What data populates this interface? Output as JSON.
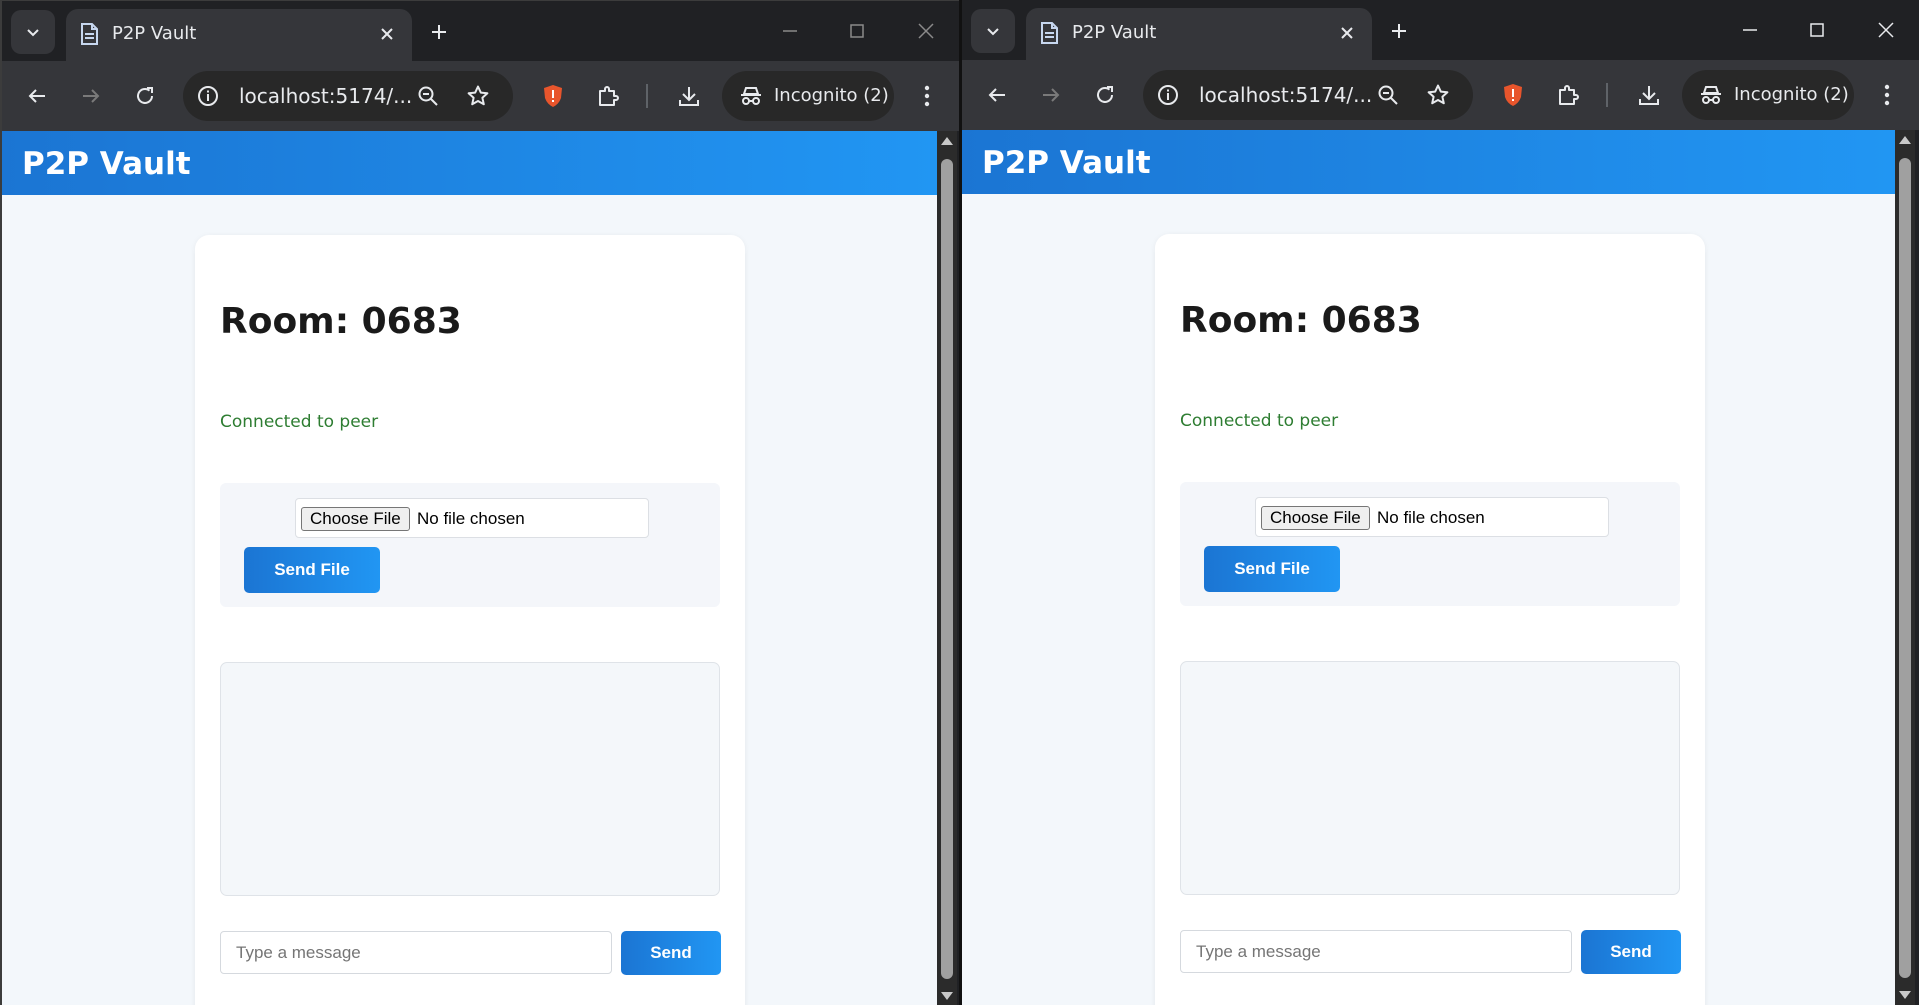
{
  "colors": {
    "brand_blue": "#1b75d3",
    "brand_blue_light": "#2196f3",
    "status_green": "#2e7d32",
    "chrome_dark": "#202124",
    "chrome_toolbar": "#35363a",
    "brave_shield": "#e8552c"
  },
  "windows": [
    {
      "tab": {
        "title": "P2P Vault",
        "favicon": "page-icon"
      },
      "omnibox": {
        "url": "localhost:5174/..."
      },
      "incognito": {
        "label": "Incognito (2)"
      },
      "app": {
        "title": "P2P Vault",
        "room_title": "Room: 0683",
        "status": "Connected to peer",
        "choose_file_label": "Choose File",
        "no_file_text": "No file chosen",
        "send_file_label": "Send File",
        "message_placeholder": "Type a message",
        "send_label": "Send"
      }
    },
    {
      "tab": {
        "title": "P2P Vault",
        "favicon": "page-icon"
      },
      "omnibox": {
        "url": "localhost:5174/..."
      },
      "incognito": {
        "label": "Incognito (2)"
      },
      "app": {
        "title": "P2P Vault",
        "room_title": "Room: 0683",
        "status": "Connected to peer",
        "choose_file_label": "Choose File",
        "no_file_text": "No file chosen",
        "send_file_label": "Send File",
        "message_placeholder": "Type a message",
        "send_label": "Send"
      }
    }
  ]
}
